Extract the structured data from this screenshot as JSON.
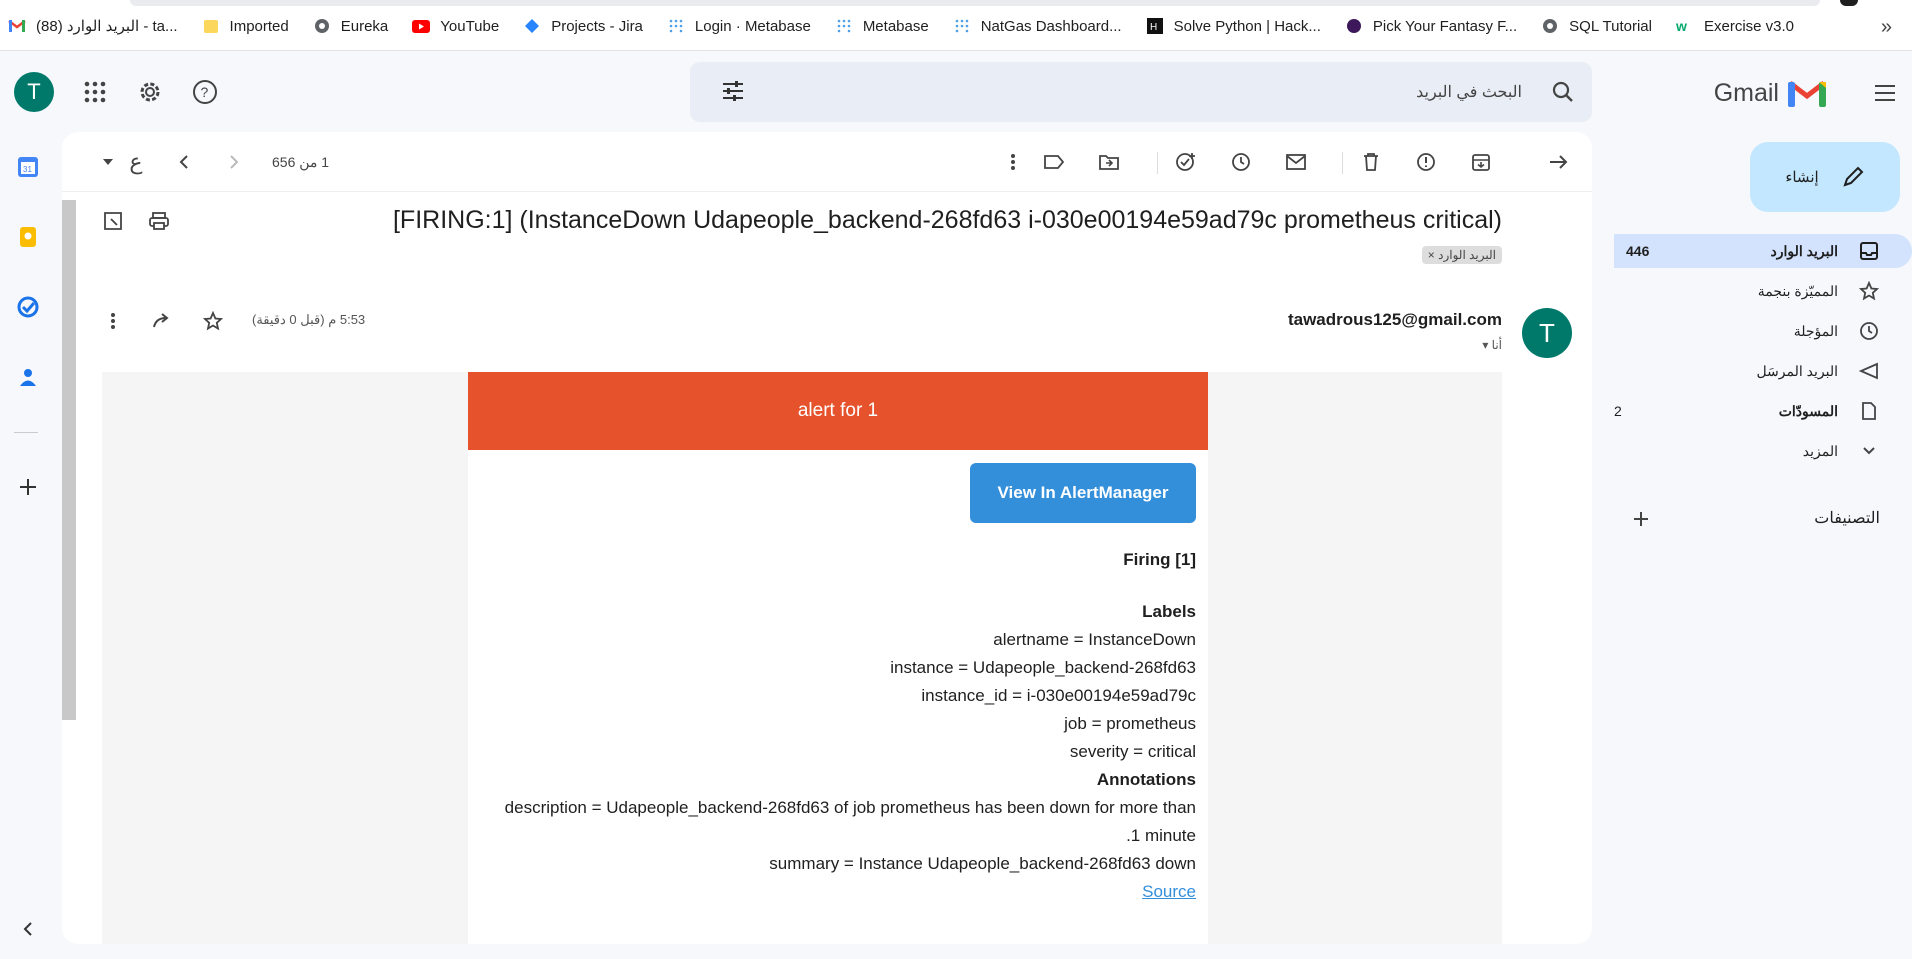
{
  "bookmarks": [
    {
      "label": "البريد الوارد (88) - ta...",
      "icon": "gmail-icon"
    },
    {
      "label": "Imported",
      "icon": "folder-icon"
    },
    {
      "label": "Eureka",
      "icon": "globe-icon"
    },
    {
      "label": "YouTube",
      "icon": "youtube-icon"
    },
    {
      "label": "Projects - Jira",
      "icon": "jira-icon"
    },
    {
      "label": "Login · Metabase",
      "icon": "metabase-icon"
    },
    {
      "label": "Metabase",
      "icon": "metabase-icon"
    },
    {
      "label": "NatGas Dashboard...",
      "icon": "metabase-icon"
    },
    {
      "label": "Solve Python | Hack...",
      "icon": "hackerrank-icon"
    },
    {
      "label": "Pick Your Fantasy F...",
      "icon": "premier-league-icon"
    },
    {
      "label": "SQL Tutorial",
      "icon": "globe-icon"
    },
    {
      "label": "Exercise v3.0",
      "icon": "w3schools-icon"
    }
  ],
  "bookmarks_more": "»",
  "account_initial": "T",
  "search": {
    "placeholder": "البحث في البريد"
  },
  "app_name": "Gmail",
  "compose_label": "إنشاء",
  "nav": [
    {
      "label": "البريد الوارد",
      "count": "446",
      "icon": "inbox-icon"
    },
    {
      "label": "المميّزة بنجمة",
      "count": "",
      "icon": "star-icon"
    },
    {
      "label": "المؤجلة",
      "count": "",
      "icon": "clock-icon"
    },
    {
      "label": "البريد المرسَل",
      "count": "",
      "icon": "send-icon"
    },
    {
      "label": "المسودّات",
      "count": "2",
      "icon": "draft-icon"
    },
    {
      "label": "المزيد",
      "count": "",
      "icon": "chevron-down-icon"
    }
  ],
  "labels_header": "التصنيفات",
  "pager": "1 من 656",
  "input_tool": "ع",
  "subject": "[FIRING:1] (InstanceDown Udapeople_backend-268fd63 i-030e00194e59ad79c prometheus critical)",
  "label_chip": "البريد الوارد ×",
  "sender": {
    "initial": "T",
    "email": "tawadrous125@gmail.com",
    "to": "أنا ▾",
    "time": "5:53 م (قبل 0 دقيقة)"
  },
  "alert": {
    "header": "alert for 1",
    "button": "View In AlertManager",
    "firing": "Firing [1]",
    "labels_title": "Labels",
    "labels": [
      "alertname = InstanceDown",
      "instance = Udapeople_backend-268fd63",
      "instance_id = i-030e00194e59ad79c",
      "job = prometheus",
      "severity = critical"
    ],
    "annotations_title": "Annotations",
    "description_1": "description = Udapeople_backend-268fd63 of job prometheus has been down for more than",
    "description_2": ".1 minute",
    "summary": "summary = Instance Udapeople_backend-268fd63 down",
    "source": "Source"
  },
  "colors": {
    "alert_red": "#e6522c",
    "button_blue": "#348fdb",
    "avatar_teal": "#00796b",
    "active_nav": "#d3e3fd"
  }
}
